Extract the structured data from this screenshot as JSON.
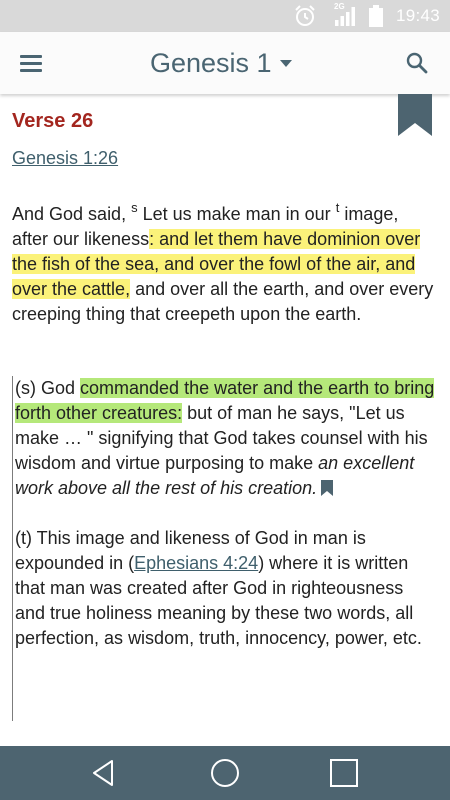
{
  "status_bar": {
    "time": "19:43",
    "network_label": "2G",
    "icons": [
      "alarm-icon",
      "signal-icon",
      "battery-icon"
    ]
  },
  "app_bar": {
    "title": "Genesis 1",
    "icons": [
      "menu-icon",
      "dropdown-caret-icon",
      "search-icon"
    ]
  },
  "content": {
    "verse_heading": "Verse 26",
    "reference": "Genesis 1:26",
    "verse": {
      "part1": "And God said, ",
      "footnote_s": "s",
      "part2": " Let us make man in our ",
      "footnote_t": "t",
      "part3": " image, after our likeness",
      "highlight": ": and let them have dominion over the fish of the sea, and over the fowl of the air, and over the cattle,",
      "part4": " and over all the earth, and over every creeping thing that creepeth upon the earth."
    },
    "note_s": {
      "prefix": "(s) God ",
      "highlight": "commanded the water and the earth to bring forth other creatures:",
      "text": " but of man he says, \"Let us make … \" signifying that God takes counsel with his wisdom and virtue purposing to make ",
      "italic": "an excellent work above all the rest of his creation."
    },
    "note_t": {
      "text1": "(t) This image and likeness of God in man is expounded in (",
      "link": "Ephesians 4:24",
      "text2": ") where it is written that man was created after God in righteousness and true holiness meaning by these two words, all perfection, as wisdom, truth, innocency, power, etc."
    }
  },
  "colors": {
    "accent": "#4a6572",
    "heading": "#a3261f",
    "highlight_yellow": "#fbf27a",
    "highlight_green": "#b5e87a",
    "nav_bar": "#4d6470"
  },
  "nav_bar": {
    "icons": [
      "back-icon",
      "home-icon",
      "recents-icon"
    ]
  }
}
